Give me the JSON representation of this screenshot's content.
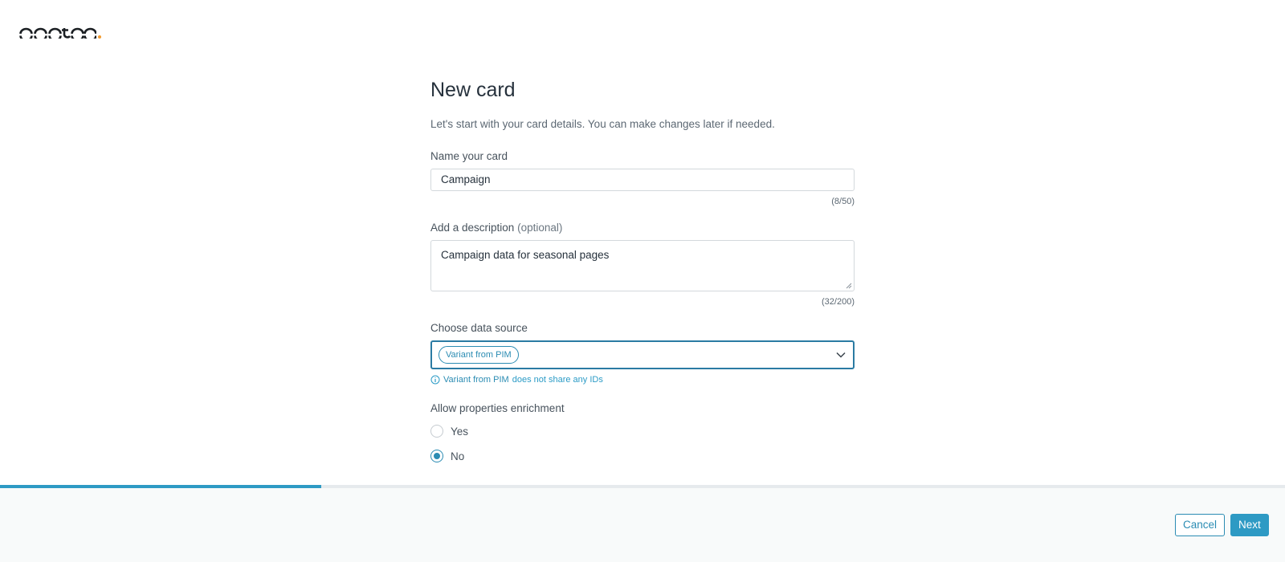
{
  "brand": {
    "accent": "#2e9ac4",
    "logo_dot_color": "#f29a2e"
  },
  "page": {
    "title": "New card",
    "subtitle": "Let's start with your card details. You can make changes later if needed."
  },
  "name_field": {
    "label": "Name your card",
    "value": "Campaign",
    "counter": "(8/50)"
  },
  "description_field": {
    "label": "Add a description",
    "optional": "(optional)",
    "value": "Campaign data for seasonal pages",
    "counter": "(32/200)"
  },
  "source_field": {
    "label": "Choose data source",
    "selected_chip": "Variant from PIM",
    "hint_source": "Variant from PIM",
    "hint_text": "does not share any IDs",
    "icons": {
      "dropdown": "chevron-down-icon",
      "hint": "info-icon"
    }
  },
  "enrichment": {
    "label": "Allow properties enrichment",
    "options": [
      {
        "label": "Yes",
        "checked": false
      },
      {
        "label": "No",
        "checked": true
      }
    ]
  },
  "progress": {
    "fraction": 0.25
  },
  "footer": {
    "cancel_label": "Cancel",
    "next_label": "Next"
  }
}
